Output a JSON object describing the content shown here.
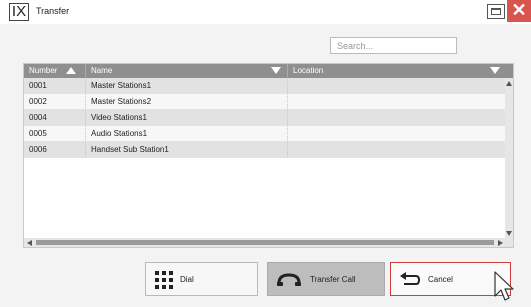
{
  "window": {
    "title": "Transfer",
    "logo_text": "IX",
    "close_symbol": "✕"
  },
  "search": {
    "placeholder": "Search...",
    "value": ""
  },
  "table": {
    "columns": [
      "Number",
      "Name",
      "Location"
    ],
    "rows": [
      {
        "number": "0001",
        "name": "Master Stations1",
        "location": ""
      },
      {
        "number": "0002",
        "name": "Master Stations2",
        "location": ""
      },
      {
        "number": "0004",
        "name": "Video Stations1",
        "location": ""
      },
      {
        "number": "0005",
        "name": "Audio Stations1",
        "location": ""
      },
      {
        "number": "0006",
        "name": "Handset Sub Station1",
        "location": ""
      }
    ]
  },
  "buttons": {
    "dial": "Dial",
    "transfer": "Transfer Call",
    "cancel": "Cancel"
  },
  "icons": {
    "dial": "keypad-icon",
    "transfer": "handset-icon",
    "cancel": "return-arrow-icon"
  },
  "colors": {
    "header_bg": "#8f8f8f",
    "close_bg": "#d9534f",
    "cancel_border": "#d23c3c",
    "transfer_bg": "#bdbdbd"
  }
}
